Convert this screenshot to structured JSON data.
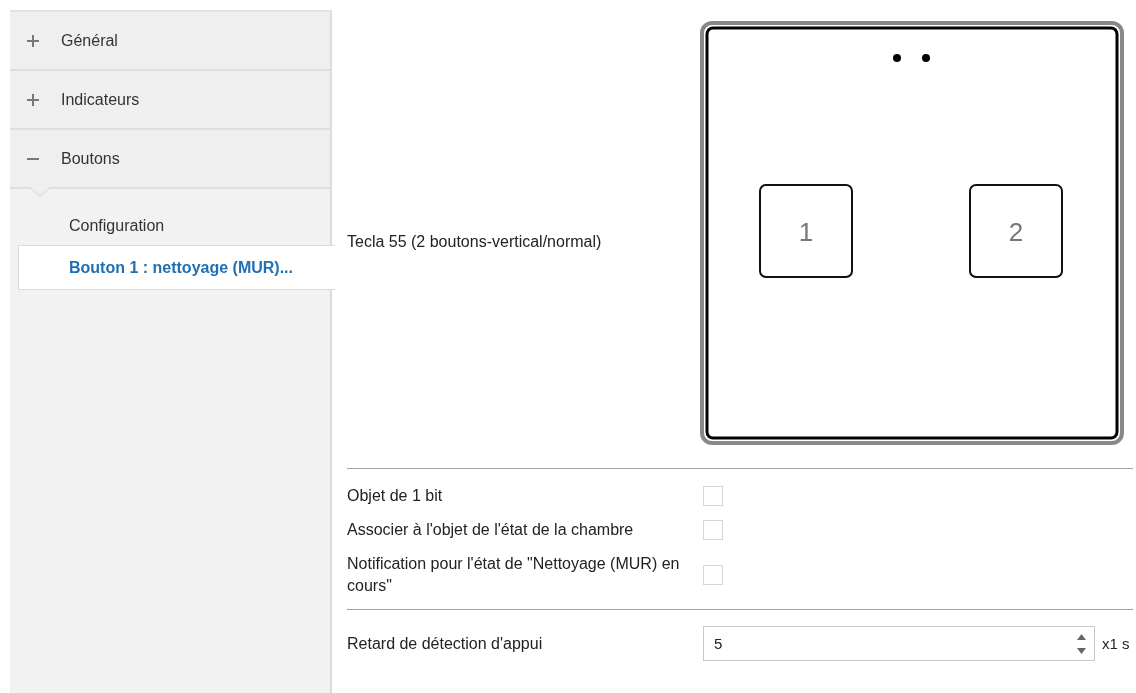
{
  "sidebar": {
    "items": [
      {
        "label": "Général",
        "expanded": false
      },
      {
        "label": "Indicateurs",
        "expanded": false
      },
      {
        "label": "Boutons",
        "expanded": true,
        "children": [
          {
            "label": "Configuration",
            "selected": false
          },
          {
            "label": "Bouton 1 : nettoyage (MUR)...",
            "selected": true
          }
        ]
      }
    ]
  },
  "device": {
    "label": "Tecla 55 (2 boutons-vertical/normal)",
    "keys": [
      "1",
      "2"
    ]
  },
  "options": [
    {
      "kind": "checkbox",
      "label": "Objet de 1 bit",
      "checked": false
    },
    {
      "kind": "checkbox",
      "label": "Associer à l'objet de l'état de la chambre",
      "checked": false
    },
    {
      "kind": "checkbox",
      "label": "Notification pour l'état de \"Nettoyage (MUR) en cours\"",
      "checked": false
    }
  ],
  "delay": {
    "label": "Retard de détection d'appui",
    "value": "5",
    "unit": "x1 s"
  }
}
